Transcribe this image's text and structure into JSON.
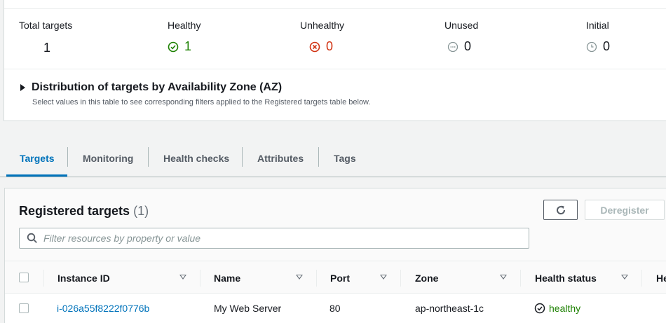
{
  "summary": {
    "total": {
      "label": "Total targets",
      "value": "1"
    },
    "healthy": {
      "label": "Healthy",
      "value": "1",
      "icon": "check-circle-icon",
      "color": "#1d8102"
    },
    "unhealthy": {
      "label": "Unhealthy",
      "value": "0",
      "icon": "x-circle-icon",
      "color": "#d13212"
    },
    "unused": {
      "label": "Unused",
      "value": "0",
      "icon": "ellipsis-circle-icon"
    },
    "initial": {
      "label": "Initial",
      "value": "0",
      "icon": "clock-icon"
    }
  },
  "distribution": {
    "title": "Distribution of targets by Availability Zone (AZ)",
    "subtitle": "Select values in this table to see corresponding filters applied to the Registered targets table below."
  },
  "tabs": [
    "Targets",
    "Monitoring",
    "Health checks",
    "Attributes",
    "Tags"
  ],
  "active_tab": "Targets",
  "registered": {
    "title": "Registered targets",
    "count": "(1)",
    "refresh_icon": "refresh-icon",
    "deregister_label": "Deregister",
    "search_placeholder": "Filter resources by property or value"
  },
  "table": {
    "columns": [
      "Instance ID",
      "Name",
      "Port",
      "Zone",
      "Health status",
      "He"
    ],
    "rows": [
      {
        "instance_id": "i-026a55f8222f0776b",
        "name": "My Web Server",
        "port": "80",
        "zone": "ap-northeast-1c",
        "health": "healthy"
      }
    ]
  },
  "colors": {
    "accent": "#0073bb",
    "healthy": "#1d8102",
    "unhealthy": "#d13212"
  }
}
